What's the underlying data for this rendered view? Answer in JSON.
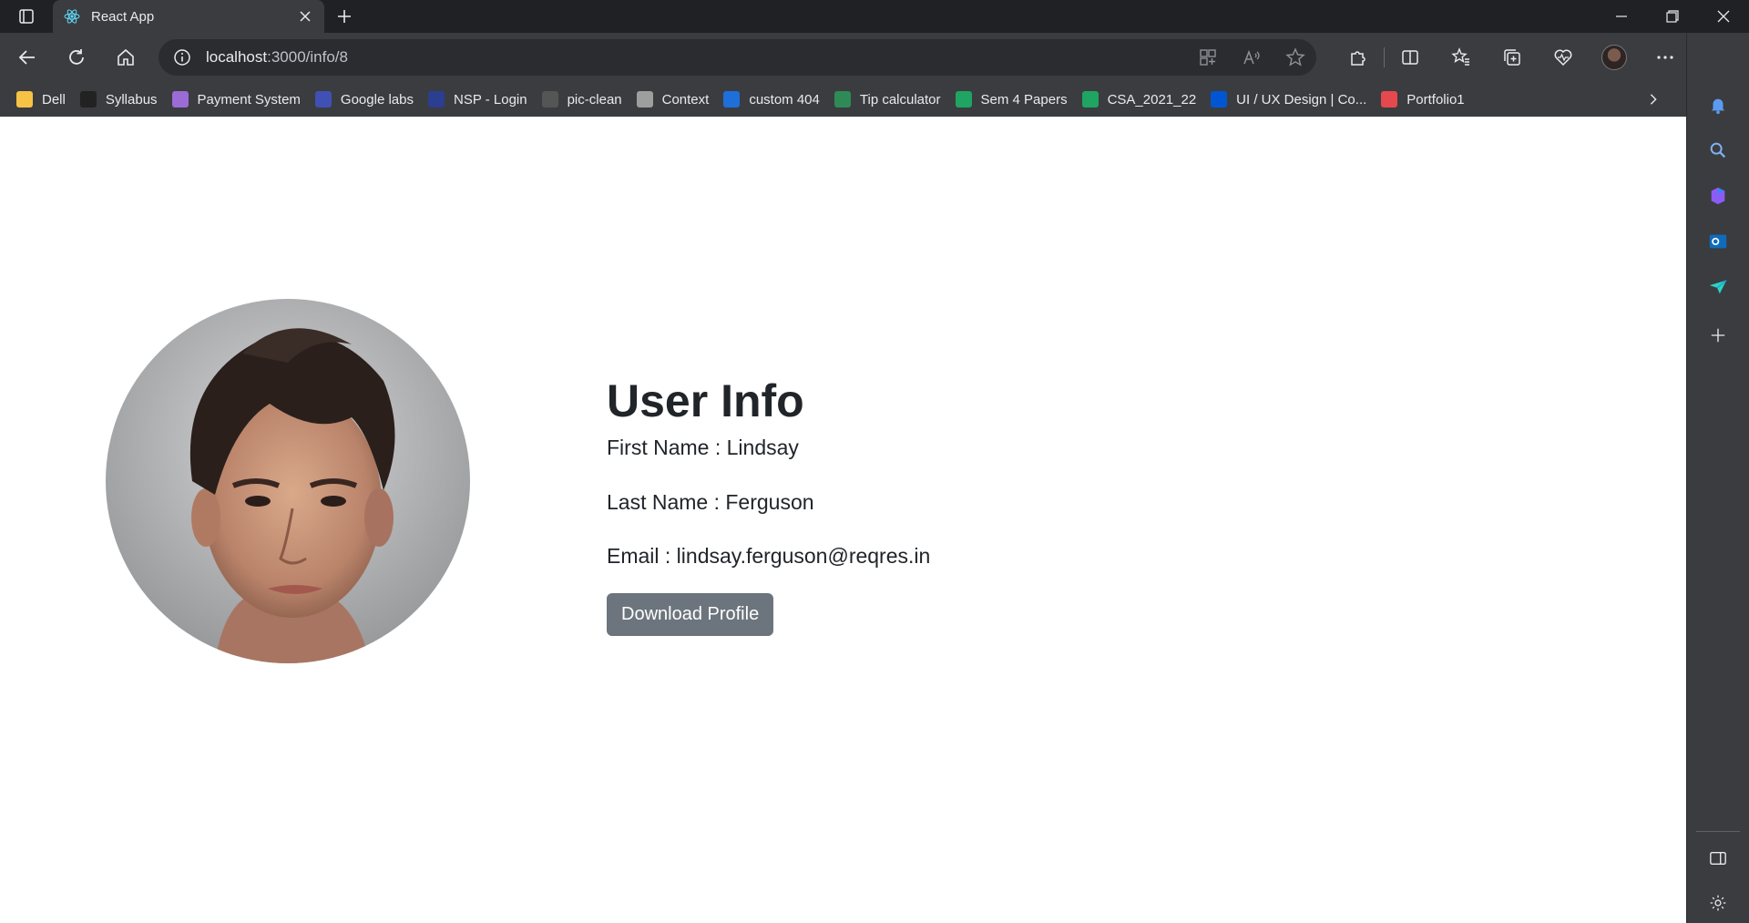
{
  "browser": {
    "tab_title": "React App",
    "url_host": "localhost",
    "url_path": ":3000/info/8"
  },
  "bookmarks": [
    {
      "label": "Dell",
      "icon": "folder-icon",
      "color": "#f6c344"
    },
    {
      "label": "Syllabus",
      "icon": "syllabus-icon",
      "color": "#222222"
    },
    {
      "label": "Payment System",
      "icon": "payment-icon",
      "color": "#9b6bd6"
    },
    {
      "label": "Google labs",
      "icon": "google-labs-icon",
      "color": "#3f51b5"
    },
    {
      "label": "NSP - Login",
      "icon": "nsp-icon",
      "color": "#2c3e8f"
    },
    {
      "label": "pic-clean",
      "icon": "pic-clean-icon",
      "color": "#555555"
    },
    {
      "label": "Context",
      "icon": "document-icon",
      "color": "#9e9e9e"
    },
    {
      "label": "custom 404",
      "icon": "infinity-icon",
      "color": "#1e6fd9"
    },
    {
      "label": "Tip calculator",
      "icon": "tip-calculator-icon",
      "color": "#2e8b57"
    },
    {
      "label": "Sem 4 Papers",
      "icon": "google-drive-icon",
      "color": "#1fa463"
    },
    {
      "label": "CSA_2021_22",
      "icon": "google-drive-icon",
      "color": "#1fa463"
    },
    {
      "label": "UI / UX Design | Co...",
      "icon": "coursera-icon",
      "color": "#0056d2"
    },
    {
      "label": "Portfolio1",
      "icon": "portfolio-icon",
      "color": "#e5484d"
    }
  ],
  "user": {
    "heading": "User Info",
    "first_name": "First Name : Lindsay",
    "last_name": "Last Name : Ferguson",
    "email": "Email : lindsay.ferguson@reqres.in",
    "download_label": "Download Profile"
  },
  "colors": {
    "button_bg": "#6c757d",
    "text": "#212529",
    "chrome_bg": "#3b3c3f"
  }
}
